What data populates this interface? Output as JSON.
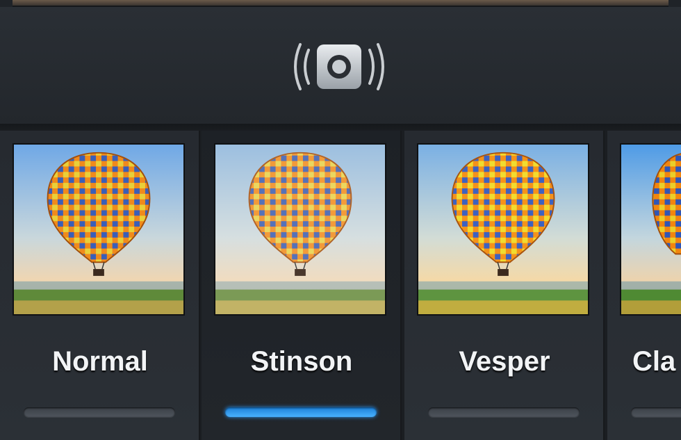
{
  "camera_button": {
    "icon": "camera-shutter-icon"
  },
  "filters": [
    {
      "label": "Normal",
      "selected": false
    },
    {
      "label": "Stinson",
      "selected": true
    },
    {
      "label": "Vesper",
      "selected": false
    },
    {
      "label": "Cla",
      "selected": false
    }
  ],
  "colors": {
    "selected_indicator": "#3aa0f5",
    "unselected_indicator": "#474c53",
    "background": "#1f2328"
  }
}
